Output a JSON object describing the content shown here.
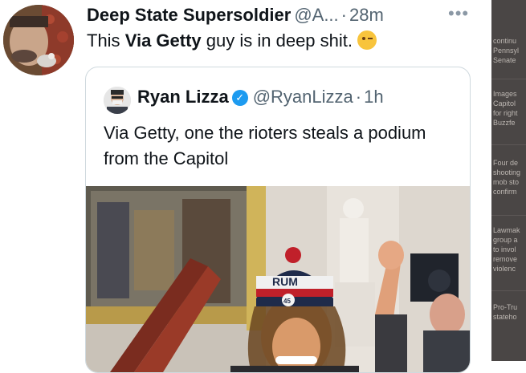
{
  "tweet": {
    "author_name": "Deep State Supersoldier",
    "author_handle": "@A...",
    "separator": "·",
    "time": "28m",
    "more_icon": "more-horizontal-icon",
    "text_before": "This ",
    "text_bold": "Via Getty",
    "text_after": " guy is in deep shit.",
    "emoji": "winking-face-icon"
  },
  "quoted_tweet": {
    "author_name": "Ryan Lizza",
    "author_handle": "@RyanLizza",
    "separator": "·",
    "time": "1h",
    "verified_icon": "verified-badge-icon",
    "text": "Via Getty, one the rioters steals a podium from the Capitol",
    "hat_text": "RUM",
    "hat_number": "45"
  },
  "right_panel": {
    "items": [
      "continu",
      "Pennsyl",
      "Senate",
      "Images",
      "Capitol",
      "for right",
      "Buzzfe",
      "Four de",
      "shooting",
      "mob sto",
      "confirm",
      "Lawmak",
      "group a",
      "to invol",
      "remove",
      "violenc",
      "Pro-Tru",
      "stateho"
    ]
  }
}
